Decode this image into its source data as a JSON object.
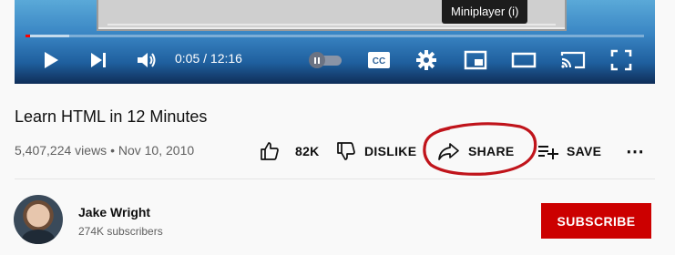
{
  "player": {
    "tooltip": "Miniplayer (i)",
    "time": "0:05 / 12:16",
    "progress_played_fraction": 0.007,
    "progress_loaded_fraction": 0.07,
    "icons": [
      "play-icon",
      "next-icon",
      "volume-icon",
      "autoplay-toggle",
      "cc-icon",
      "settings-icon",
      "miniplayer-icon",
      "theater-icon",
      "cast-icon",
      "fullscreen-icon"
    ]
  },
  "video": {
    "title": "Learn HTML in 12 Minutes",
    "meta": "5,407,224 views • Nov 10, 2010"
  },
  "actions": {
    "like_count": "82K",
    "dislike_label": "DISLIKE",
    "share_label": "SHARE",
    "save_label": "SAVE",
    "more_label": "⋯"
  },
  "annotation": {
    "color": "#c0141b"
  },
  "channel": {
    "name": "Jake Wright",
    "subscribers": "274K subscribers",
    "subscribe_label": "SUBSCRIBE"
  },
  "colors": {
    "subscribe": "#cc0000",
    "progress": "#ff0000"
  }
}
